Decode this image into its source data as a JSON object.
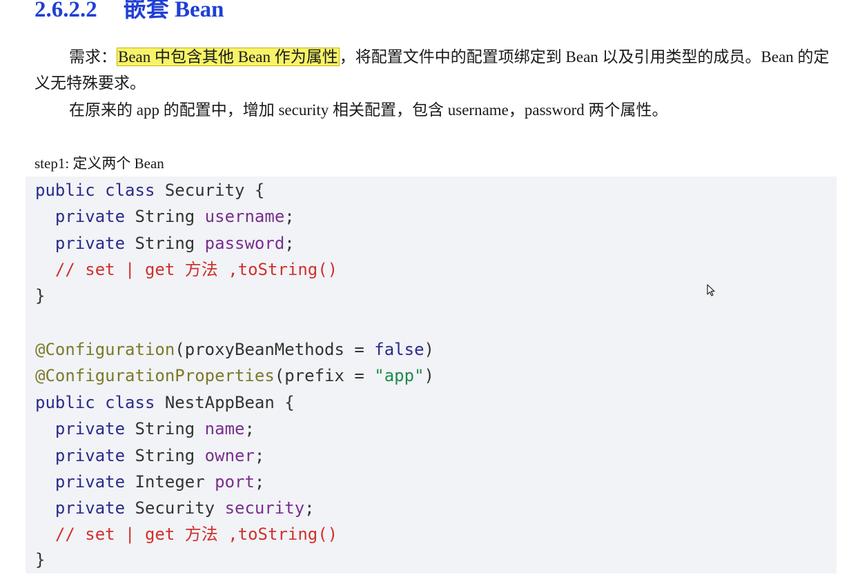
{
  "heading": {
    "number": "2.6.2.2",
    "title": "嵌套 Bean"
  },
  "paragraph1": {
    "lead": "需求：",
    "highlight": "Bean 中包含其他 Bean 作为属性",
    "rest": "，将配置文件中的配置项绑定到 Bean 以及引用类型的成员。Bean 的定义无特殊要求。"
  },
  "paragraph2": {
    "text": "在原来的 app 的配置中，增加 security 相关配置，包含 username，password 两个属性。"
  },
  "step_label": "step1: 定义两个 Bean",
  "code": {
    "kw_public": "public",
    "kw_class": "class",
    "kw_private": "private",
    "brace_open": "{",
    "brace_close": "}",
    "semicolon": ";",
    "class1_name": "Security",
    "class1_fields": [
      {
        "type": "String",
        "name": "username"
      },
      {
        "type": "String",
        "name": "password"
      }
    ],
    "comment": "// set | get 方法 ,toString()",
    "anno1": "@Configuration",
    "anno1_args_open": "(proxyBeanMethods = ",
    "anno1_value": "false",
    "anno1_args_close": ")",
    "anno2": "@ConfigurationProperties",
    "anno2_args_open": "(prefix = ",
    "anno2_value": "\"app\"",
    "anno2_args_close": ")",
    "class2_name": "NestAppBean",
    "class2_fields": [
      {
        "type": "String",
        "name": "name"
      },
      {
        "type": "String",
        "name": "owner"
      },
      {
        "type": "Integer",
        "name": "port"
      },
      {
        "type": "Security",
        "name": "security"
      }
    ]
  }
}
